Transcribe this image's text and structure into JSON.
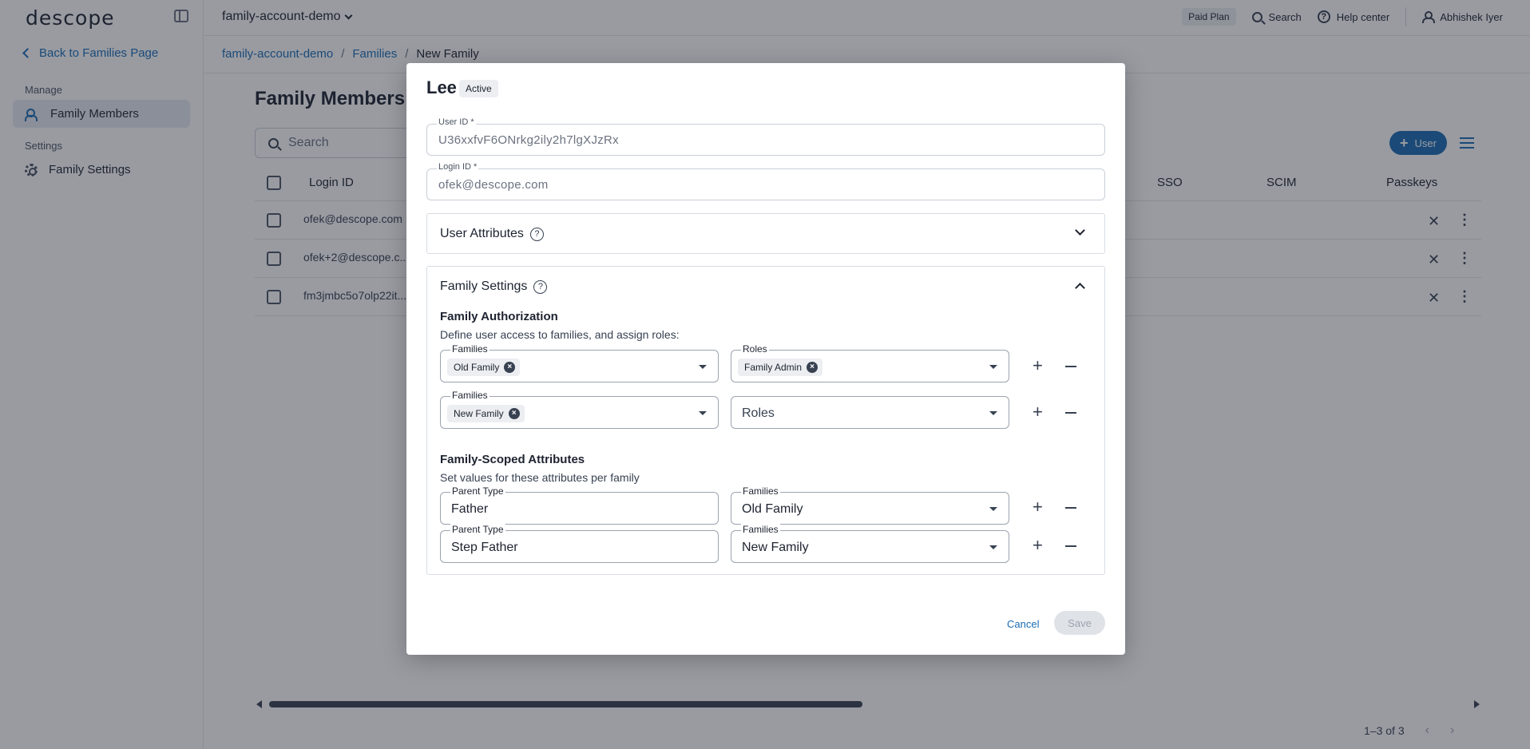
{
  "sidebar": {
    "logo": "descope",
    "back_label": "Back to Families Page",
    "manage_section": "Manage",
    "settings_section": "Settings",
    "items": [
      {
        "label": "Family Members"
      },
      {
        "label": "Family Settings"
      }
    ]
  },
  "topbar": {
    "project": "family-account-demo",
    "plan": "Paid Plan",
    "search": "Search",
    "help": "Help center",
    "user": "Abhishek Iyer"
  },
  "breadcrumb": [
    "family-account-demo",
    "Families",
    "New Family"
  ],
  "main": {
    "title": "Family Members",
    "search_placeholder": "Search",
    "add_user_label": "User",
    "columns": [
      "Login ID",
      "SSO",
      "SCIM",
      "Passkeys"
    ],
    "rows": [
      {
        "login_id": "ofek@descope.com"
      },
      {
        "login_id": "ofek+2@descope.c..."
      },
      {
        "login_id": "fm3jmbc5o7olp22it..."
      }
    ],
    "pagination": "1–3 of 3"
  },
  "modal": {
    "name": "Lee",
    "status": "Active",
    "user_id_label": "User ID *",
    "user_id": "U36xxfvF6ONrkg2ily2h7lgXJzRx",
    "login_id_label": "Login ID *",
    "login_id": "ofek@descope.com",
    "user_attributes": "User Attributes",
    "family_settings": "Family Settings",
    "authorization": {
      "title": "Family Authorization",
      "desc": "Define user access to families, and assign roles:",
      "families_label": "Families",
      "roles_label": "Roles",
      "rows": [
        {
          "family": "Old Family",
          "role": "Family Admin"
        },
        {
          "family": "New Family",
          "role": ""
        }
      ],
      "roles_placeholder": "Roles"
    },
    "scoped": {
      "title": "Family-Scoped Attributes",
      "desc": "Set values for these attributes per family",
      "attr_label": "Parent Type",
      "families_label": "Families",
      "rows": [
        {
          "value": "Father",
          "family": "Old Family"
        },
        {
          "value": "Step Father",
          "family": "New Family"
        }
      ]
    },
    "cancel": "Cancel",
    "save": "Save"
  }
}
